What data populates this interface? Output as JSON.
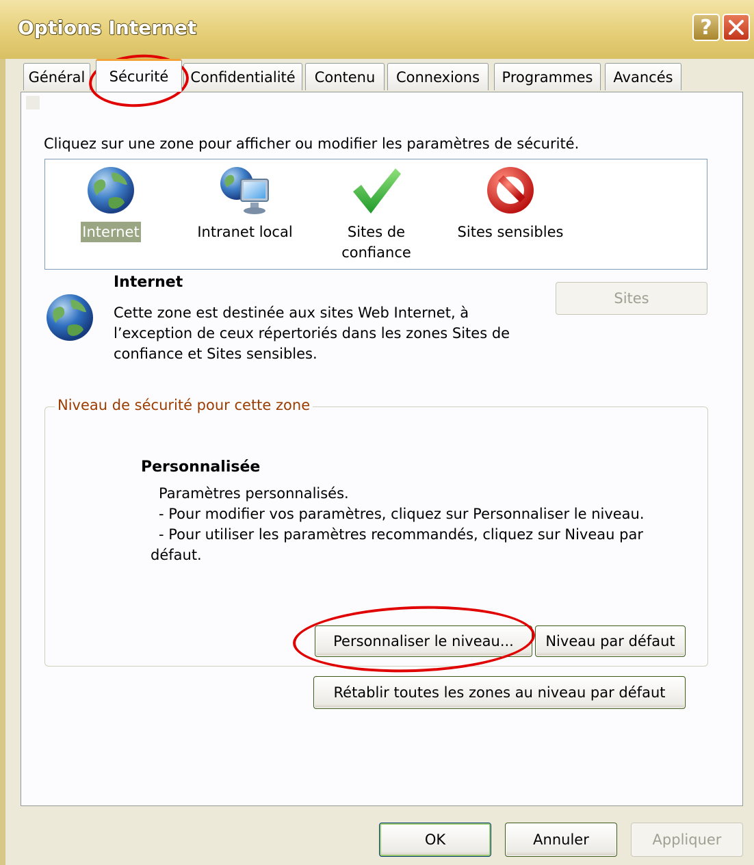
{
  "window": {
    "title": "Options Internet",
    "help_icon": "?",
    "close_icon": "close-icon"
  },
  "tabs": [
    {
      "label": "Général"
    },
    {
      "label": "Sécurité",
      "active": true
    },
    {
      "label": "Confidentialité"
    },
    {
      "label": "Contenu"
    },
    {
      "label": "Connexions"
    },
    {
      "label": "Programmes"
    },
    {
      "label": "Avancés"
    }
  ],
  "security": {
    "instruction": "Cliquez sur une zone pour afficher ou modifier les paramètres de sécurité.",
    "zones": [
      {
        "label": "Internet",
        "icon": "globe-icon",
        "selected": true
      },
      {
        "label": "Intranet local",
        "icon": "intranet-monitor-icon"
      },
      {
        "label_line1": "Sites de",
        "label_line2": "confiance",
        "icon": "trusted-check-icon"
      },
      {
        "label": "Sites sensibles",
        "icon": "restricted-icon"
      }
    ],
    "info": {
      "title": "Internet",
      "description": "Cette zone est destinée aux sites Web Internet, à l’exception de ceux répertoriés dans les zones Sites de confiance et Sites sensibles.",
      "sites_button": "Sites"
    },
    "level_group": {
      "legend": "Niveau de sécurité pour cette zone",
      "title": "Personnalisée",
      "lines": [
        "Paramètres personnalisés.",
        "- Pour modifier vos paramètres, cliquez sur Personnaliser le niveau.",
        "- Pour utiliser les paramètres recommandés, cliquez sur Niveau par",
        "défaut."
      ],
      "custom_level_button": "Personnaliser le niveau...",
      "default_level_button": "Niveau par défaut"
    },
    "reset_all_button": "Rétablir toutes les zones au niveau par défaut"
  },
  "footer": {
    "ok": "OK",
    "cancel": "Annuler",
    "apply": "Appliquer"
  },
  "colors": {
    "annotation": "#e00000",
    "group_legend": "#9b3c00",
    "selection": "#9aa583"
  }
}
